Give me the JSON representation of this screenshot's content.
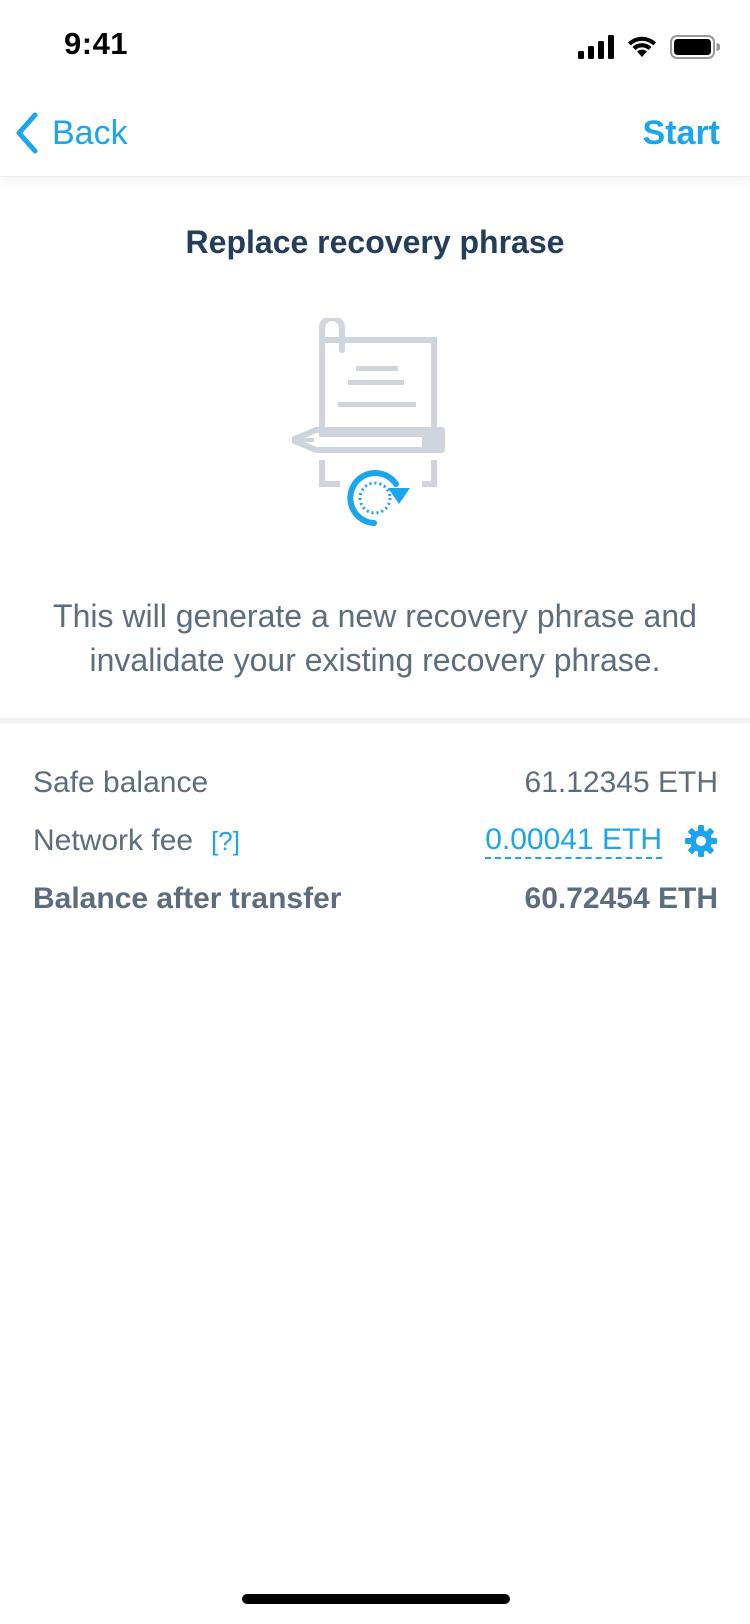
{
  "status_bar": {
    "time": "9:41",
    "icons": [
      "signal-icon",
      "wifi-icon",
      "battery-icon"
    ]
  },
  "nav": {
    "back_label": "Back",
    "start_label": "Start"
  },
  "content": {
    "title": "Replace recovery phrase",
    "illustration": "document-replace-icon",
    "description": "This will generate a new recovery phrase and invalidate your existing recovery phrase."
  },
  "summary": {
    "safe_balance_label": "Safe balance",
    "safe_balance_value": "61.12345 ETH",
    "network_fee_label": "Network fee",
    "network_fee_help": "[?]",
    "network_fee_value": "0.00041 ETH",
    "fee_settings_icon": "gear-icon",
    "balance_after_label": "Balance after transfer",
    "balance_after_value": "60.72454 ETH"
  },
  "colors": {
    "accent": "#1aa5ec",
    "title": "#243d58",
    "text": "#5d6d7e",
    "illustration_gray": "#d0d4dd"
  }
}
